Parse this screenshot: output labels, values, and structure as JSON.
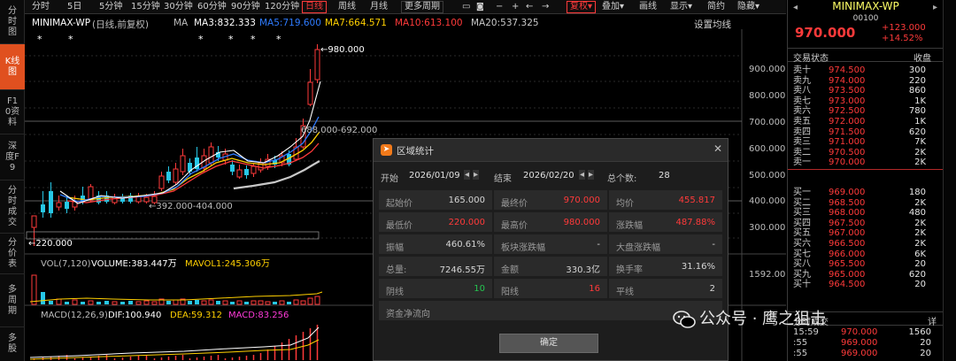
{
  "left_tabs": [
    "分时图",
    "K线图",
    "F10资料",
    "深度F9",
    "分时成交",
    "分价表",
    "多周期",
    "多股"
  ],
  "toolbar": {
    "periods": [
      "分时",
      "5日",
      "5分钟",
      "15分钟",
      "30分钟",
      "60分钟",
      "90分钟",
      "120分钟",
      "日线",
      "周线",
      "月线",
      "更多周期"
    ],
    "active_period": "日线",
    "restore": "复权",
    "overlay": "叠加",
    "draw": "画线",
    "display": "显示",
    "simple": "简约",
    "hide": "隐藏"
  },
  "chart": {
    "title": "MINIMAX-WP",
    "mode": "(日线,前复权)",
    "ma_label": "MA",
    "ma3": "MA3:832.333",
    "ma5": "MA5:719.600",
    "ma7": "MA7:664.571",
    "ma10": "MA10:613.100",
    "ma20": "MA20:537.325",
    "settings": "设置均线",
    "annot_high": "980.000",
    "annot_low": "220.000",
    "annot_range1": "688.000-692.000",
    "annot_range2": "392.000-404.000",
    "y_labels": [
      "900.000",
      "800.000",
      "700.000",
      "600.000",
      "500.000",
      "400.000",
      "300.000"
    ],
    "colors": {
      "ma3": "#ffffff",
      "ma5": "#2e7bff",
      "ma7": "#ffd000",
      "ma10": "#ff3a3a",
      "ma20": "#c8c8c8",
      "up": "#ff3a3a",
      "down": "#27c7e6"
    }
  },
  "vol": {
    "label": "VOL(7,120)",
    "volume": "VOLUME:383.447万",
    "mavol": "MAVOL1:245.306万",
    "y_label": "1592.00"
  },
  "macd": {
    "label": "MACD(12,26,9)",
    "dif": "DIF:100.940",
    "dea": "DEA:59.312",
    "macd": "MACD:83.256"
  },
  "right": {
    "name": "MINIMAX-WP",
    "code": "00100",
    "price": "970.000",
    "change": "+123.000",
    "pct": "+14.52%",
    "status_label": "交易状态",
    "status_value": "收盘",
    "asks": [
      {
        "label": "卖十",
        "price": "974.500",
        "vol": "300"
      },
      {
        "label": "卖九",
        "price": "974.000",
        "vol": "220"
      },
      {
        "label": "卖八",
        "price": "973.500",
        "vol": "860"
      },
      {
        "label": "卖七",
        "price": "973.000",
        "vol": "1K"
      },
      {
        "label": "卖六",
        "price": "972.500",
        "vol": "780"
      },
      {
        "label": "卖五",
        "price": "972.000",
        "vol": "1K"
      },
      {
        "label": "卖四",
        "price": "971.500",
        "vol": "620"
      },
      {
        "label": "卖三",
        "price": "971.000",
        "vol": "7K"
      },
      {
        "label": "卖二",
        "price": "970.500",
        "vol": "2K"
      },
      {
        "label": "卖一",
        "price": "970.000",
        "vol": "2K"
      }
    ],
    "bids": [
      {
        "label": "买一",
        "price": "969.000",
        "vol": "180"
      },
      {
        "label": "买二",
        "price": "968.500",
        "vol": "2K"
      },
      {
        "label": "买三",
        "price": "968.000",
        "vol": "480"
      },
      {
        "label": "买四",
        "price": "967.500",
        "vol": "2K"
      },
      {
        "label": "买五",
        "price": "967.000",
        "vol": "2K"
      },
      {
        "label": "买六",
        "price": "966.500",
        "vol": "2K"
      },
      {
        "label": "买七",
        "price": "966.000",
        "vol": "6K"
      },
      {
        "label": "买八",
        "price": "965.500",
        "vol": "20"
      },
      {
        "label": "买九",
        "price": "965.000",
        "vol": "620"
      },
      {
        "label": "买十",
        "price": "964.500",
        "vol": "20"
      }
    ],
    "trades_label": "分时成交",
    "trades_detail": "详",
    "trades": [
      {
        "time": "15:59",
        "price": "970.000",
        "vol": "1560"
      },
      {
        "time": ":55",
        "price": "969.000",
        "vol": "20"
      },
      {
        "time": ":55",
        "price": "969.000",
        "vol": "20"
      }
    ]
  },
  "dialog": {
    "title": "区域统计",
    "start_label": "开始",
    "start_date": "2026/01/09",
    "end_label": "结束",
    "end_date": "2026/02/20",
    "total_label": "总个数:",
    "total_value": "28",
    "rows": [
      [
        {
          "l": "起始价",
          "v": "165.000"
        },
        {
          "l": "最终价",
          "v": "970.000"
        },
        {
          "l": "均价",
          "v": "455.817"
        }
      ],
      [
        {
          "l": "最低价",
          "v": "220.000"
        },
        {
          "l": "最高价",
          "v": "980.000"
        },
        {
          "l": "涨跌幅",
          "v": "487.88%"
        }
      ],
      [
        {
          "l": "振幅",
          "v": "460.61%"
        },
        {
          "l": "板块涨跌幅",
          "v": "-"
        },
        {
          "l": "大盘涨跌幅",
          "v": "-"
        }
      ],
      [
        {
          "l": "总量:",
          "v": "7246.55万"
        },
        {
          "l": "金额",
          "v": "330.3亿"
        },
        {
          "l": "换手率",
          "v": "31.16%"
        }
      ],
      [
        {
          "l": "阴线",
          "v": "10"
        },
        {
          "l": "阳线",
          "v": "16"
        },
        {
          "l": "平线",
          "v": "2"
        }
      ]
    ],
    "flow_label": "资金净流向",
    "ok_label": "确定"
  },
  "watermark": "公众号 · 鹰之狙击"
}
